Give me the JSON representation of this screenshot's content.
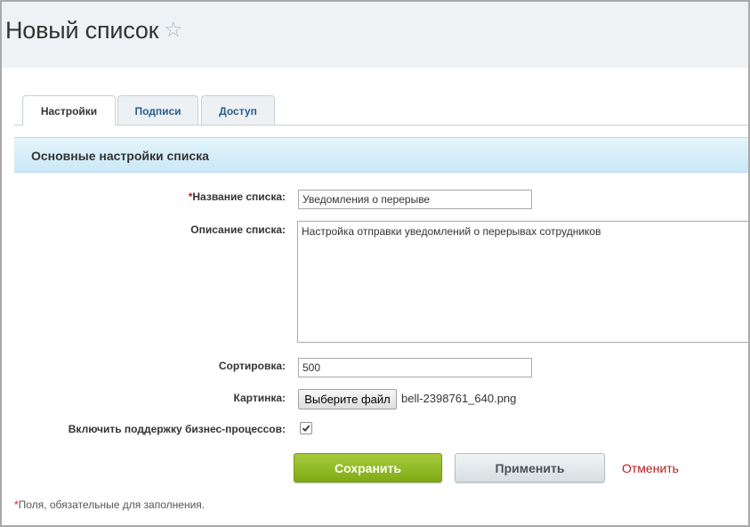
{
  "header": {
    "title": "Новый список",
    "star_icon": "star-outline-icon"
  },
  "tabs": [
    {
      "label": "Настройки",
      "active": true
    },
    {
      "label": "Подписи",
      "active": false
    },
    {
      "label": "Доступ",
      "active": false
    }
  ],
  "section": {
    "title": "Основные настройки списка"
  },
  "form": {
    "name_required_mark": "*",
    "name_label": "Название списка:",
    "name_value": "Уведомления о перерыве",
    "description_label": "Описание списка:",
    "description_value": "Настройка отправки уведомлений о перерывах сотрудников",
    "sort_label": "Сортировка:",
    "sort_value": "500",
    "image_label": "Картинка:",
    "file_button_label": "Выберите файл",
    "file_name": "bell-2398761_640.png",
    "bizproc_label": "Включить поддержку бизнес-процессов:",
    "bizproc_checked": true
  },
  "buttons": {
    "save_label": "Сохранить",
    "apply_label": "Применить",
    "cancel_label": "Отменить"
  },
  "footnote": {
    "mark": "*",
    "text": "Поля, обязательные для заполнения."
  },
  "colors": {
    "save_button": "#8cb526",
    "cancel_link": "#b51d1d",
    "section_header": "#d5eef9",
    "required_mark": "#c61c1c"
  }
}
